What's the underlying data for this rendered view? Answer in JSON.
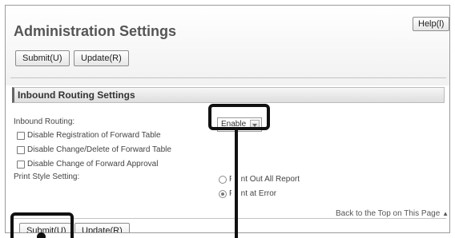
{
  "header": {
    "title": "Administration Settings",
    "help_label": "Help(l)"
  },
  "toolbar": {
    "submit_label": "Submit(U)",
    "update_label": "Update(R)"
  },
  "section": {
    "title": "Inbound Routing Settings"
  },
  "form": {
    "inbound_routing_label": "Inbound Routing:",
    "inbound_routing_value": "Enable",
    "checkboxes": [
      {
        "label": "Disable Registration of Forward Table",
        "checked": false
      },
      {
        "label": "Disable Change/Delete of Forward Table",
        "checked": false
      },
      {
        "label": "Disable Change of Forward Approval",
        "checked": false
      }
    ],
    "print_style_label": "Print Style Setting:",
    "print_options": [
      {
        "label": "P",
        "suffix": "nt Out All Report",
        "selected": false
      },
      {
        "label": "P",
        "suffix": "nt at Error",
        "selected": true
      }
    ]
  },
  "footer": {
    "back_to_top": "Back to the Top on This Page",
    "back_icon": "triangle-up-icon",
    "submit_label": "Submit(U)",
    "update_label": "Update(R)"
  }
}
